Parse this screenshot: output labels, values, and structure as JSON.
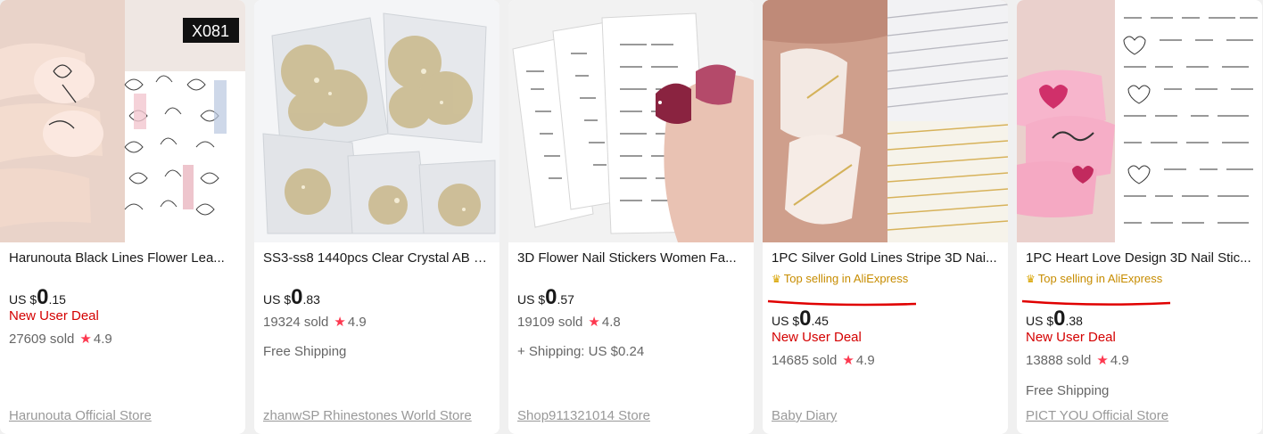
{
  "products": [
    {
      "badge_code": "X081",
      "title": "Harunouta Black Lines Flower Lea...",
      "currency": "US $",
      "price_int": "0",
      "price_dec": ".15",
      "deal": "New User Deal",
      "sold": "27609 sold",
      "rating": "4.9",
      "shipping": "",
      "store": "Harunouta Official Store"
    },
    {
      "title": "SS3-ss8 1440pcs Clear Crystal AB g...",
      "currency": "US $",
      "price_int": "0",
      "price_dec": ".83",
      "sold": "19324 sold",
      "rating": "4.9",
      "shipping": "Free Shipping",
      "store": "zhanwSP Rhinestones World Store"
    },
    {
      "title": "3D Flower Nail Stickers Women Fa...",
      "currency": "US $",
      "price_int": "0",
      "price_dec": ".57",
      "sold": "19109 sold",
      "rating": "4.8",
      "shipping": "+ Shipping: US $0.24",
      "store": "Shop911321014 Store"
    },
    {
      "title": "1PC Silver Gold Lines Stripe 3D Nai...",
      "top_selling": "Top selling in AliExpress",
      "currency": "US $",
      "price_int": "0",
      "price_dec": ".45",
      "deal": "New User Deal",
      "sold": "14685 sold",
      "rating": "4.9",
      "shipping": "",
      "store": "Baby Diary"
    },
    {
      "title": "1PC Heart Love Design 3D Nail Stic...",
      "top_selling": "Top selling in AliExpress",
      "currency": "US $",
      "price_int": "0",
      "price_dec": ".38",
      "deal": "New User Deal",
      "sold": "13888 sold",
      "rating": "4.9",
      "shipping": "Free Shipping",
      "store": "PICT YOU Official Store"
    }
  ],
  "icons": {
    "star": "star-icon",
    "crown": "crown-icon"
  },
  "colors": {
    "deal": "#d40000",
    "star": "#fd384f",
    "top_selling": "#c78c00",
    "annotation_underline": "#e00000"
  }
}
